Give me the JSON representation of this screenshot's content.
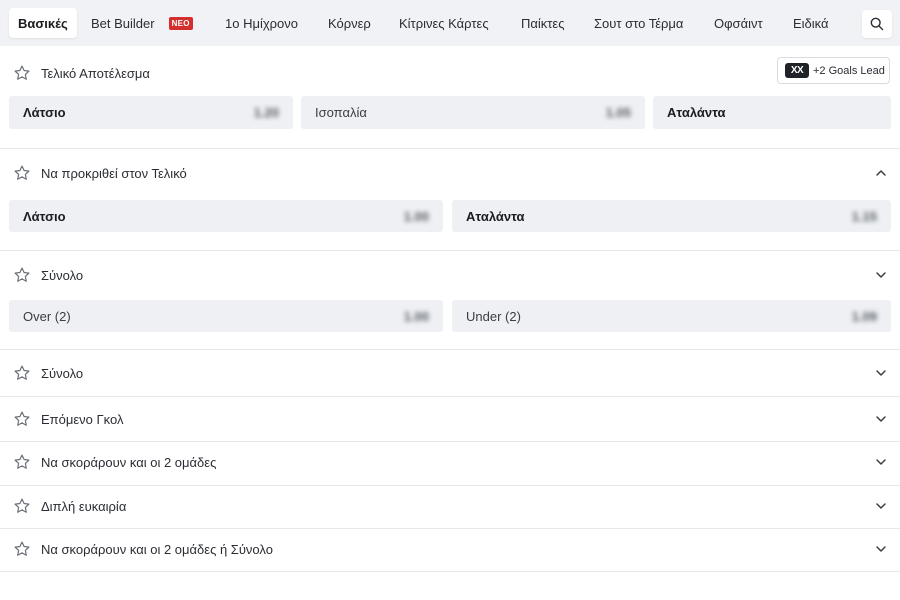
{
  "tabs": [
    {
      "label": "Βασικές",
      "active": true
    },
    {
      "label": "Bet Builder",
      "badge": "ΝΕΟ"
    },
    {
      "label": "1ο Ημίχρονο"
    },
    {
      "label": "Κόρνερ"
    },
    {
      "label": "Κίτρινες Κάρτες"
    },
    {
      "label": "Παίκτες"
    },
    {
      "label": "Σουτ στο Τέρμα"
    },
    {
      "label": "Οφσάιντ"
    },
    {
      "label": "Ειδικά"
    }
  ],
  "search_icon": "search-icon",
  "markets": [
    {
      "title": "Τελικό Αποτέλεσμα",
      "action": {
        "icon": "XX",
        "label": "+2 Goals Lead"
      },
      "selections": [
        {
          "label": "Λάτσιο",
          "odds": "1.20"
        },
        {
          "label": "Ισοπαλία",
          "odds": "1.05"
        },
        {
          "label": "Αταλάντα",
          "odds": ""
        }
      ]
    },
    {
      "title": "Να προκριθεί στον Τελικό",
      "expanded": true,
      "selections": [
        {
          "label": "Λάτσιο",
          "odds": "1.00"
        },
        {
          "label": "Αταλάντα",
          "odds": "1.15"
        }
      ]
    },
    {
      "title": "Σύνολο",
      "selections": [
        {
          "label": "Over (2)",
          "odds": "1.00"
        },
        {
          "label": "Under (2)",
          "odds": "1.09"
        }
      ]
    },
    {
      "title": "Σύνολο"
    },
    {
      "title": "Επόμενο Γκολ"
    },
    {
      "title": "Να σκοράρουν και οι 2 ομάδες"
    },
    {
      "title": "Διπλή ευκαιρία"
    },
    {
      "title": "Να σκοράρουν και οι 2 ομάδες ή Σύνολο"
    }
  ],
  "colors": {
    "background": "#f4f5f7",
    "panel": "#ffffff",
    "selection_bg": "#eef0f3",
    "badge_new": "#d32f2f",
    "text": "#1c1f24"
  }
}
